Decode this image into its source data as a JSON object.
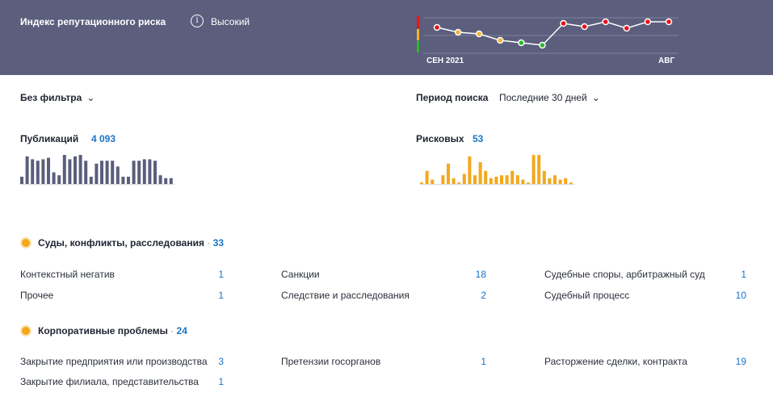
{
  "banner": {
    "title": "Индекс репутационного риска",
    "info_icon": "info-icon",
    "risk_level": "Высокий",
    "risk_chart": {
      "x_start_label": "СЕН 2021",
      "x_end_label": "АВГ",
      "levels": [
        "high",
        "medium",
        "medium",
        "medium",
        "low",
        "low",
        "high",
        "high",
        "high",
        "high",
        "high",
        "high"
      ],
      "scale_colors": {
        "high": "#e8141c",
        "medium": "#f3b233",
        "low": "#2eb82e"
      },
      "line_color": "#ffffff"
    }
  },
  "filter": {
    "label": "Без фильтра",
    "chevron_icon": "chevron-down-icon"
  },
  "period": {
    "label": "Период поиска",
    "value": "Последние 30 дней",
    "chevron_icon": "chevron-down-icon"
  },
  "publications": {
    "label": "Публикаций",
    "count": "4 093",
    "color": "#5b5e7c",
    "bars": [
      0.25,
      0.95,
      0.85,
      0.8,
      0.85,
      0.9,
      0.4,
      0.3,
      1,
      0.85,
      0.95,
      1,
      0.8,
      0.25,
      0.7,
      0.8,
      0.8,
      0.8,
      0.6,
      0.25,
      0.25,
      0.8,
      0.8,
      0.85,
      0.85,
      0.8,
      0.3,
      0.2,
      0.2
    ]
  },
  "risky": {
    "label": "Рисковых",
    "count": "53",
    "color": "#f3a81c",
    "bars": [
      0.05,
      0.45,
      0.15,
      0,
      0.3,
      0.7,
      0.2,
      0.05,
      0.35,
      0.95,
      0.3,
      0.75,
      0.45,
      0.2,
      0.25,
      0.3,
      0.3,
      0.45,
      0.3,
      0.15,
      0.05,
      1,
      1,
      0.45,
      0.2,
      0.3,
      0.15,
      0.2,
      0.05
    ]
  },
  "sections": [
    {
      "title": "Суды, конфликты, расследования",
      "count": "33",
      "items": [
        {
          "label": "Контекстный негатив",
          "value": "1"
        },
        {
          "label": "Санкции",
          "value": "18"
        },
        {
          "label": "Судебные споры, арбитражный суд",
          "value": "1"
        },
        {
          "label": "Прочее",
          "value": "1"
        },
        {
          "label": "Следствие и расследования",
          "value": "2"
        },
        {
          "label": "Судебный процесс",
          "value": "10"
        }
      ]
    },
    {
      "title": "Корпоративные проблемы",
      "count": "24",
      "items": [
        {
          "label": "Закрытие предприятия или производства",
          "value": "3"
        },
        {
          "label": "Претензии госорганов",
          "value": "1"
        },
        {
          "label": "Расторжение сделки, контракта",
          "value": "19"
        },
        {
          "label": "Закрытие филиала, представительства",
          "value": "1"
        }
      ]
    }
  ],
  "separator": "·"
}
